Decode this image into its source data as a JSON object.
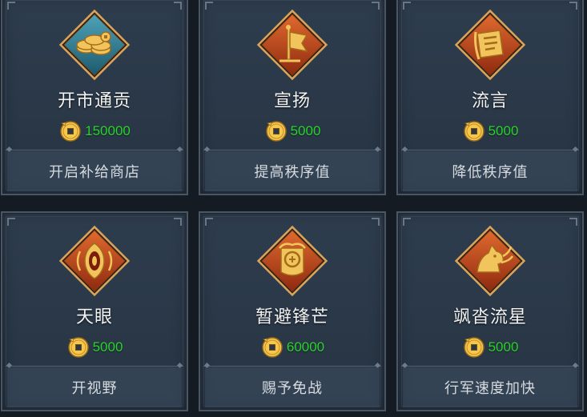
{
  "currency_icon": "copper-coin-icon",
  "colors": {
    "price": "#29d42b",
    "card_bg": "#2a3848",
    "orange_badge": "#c1451c",
    "blue_badge": "#2d7d94"
  },
  "cards": [
    {
      "title": "开市通贡",
      "price": "150000",
      "desc": "开启补给商店",
      "icon": "coins-stack-icon"
    },
    {
      "title": "宣扬",
      "price": "5000",
      "desc": "提高秩序值",
      "icon": "banner-flag-icon"
    },
    {
      "title": "流言",
      "price": "5000",
      "desc": "降低秩序值",
      "icon": "rumor-scroll-icon"
    },
    {
      "title": "天眼",
      "price": "5000",
      "desc": "开视野",
      "icon": "heaven-eye-icon"
    },
    {
      "title": "暂避锋芒",
      "price": "60000",
      "desc": "赐予免战",
      "icon": "avoid-battle-icon"
    },
    {
      "title": "飒沓流星",
      "price": "5000",
      "desc": "行军速度加快",
      "icon": "meteor-horse-icon"
    }
  ]
}
